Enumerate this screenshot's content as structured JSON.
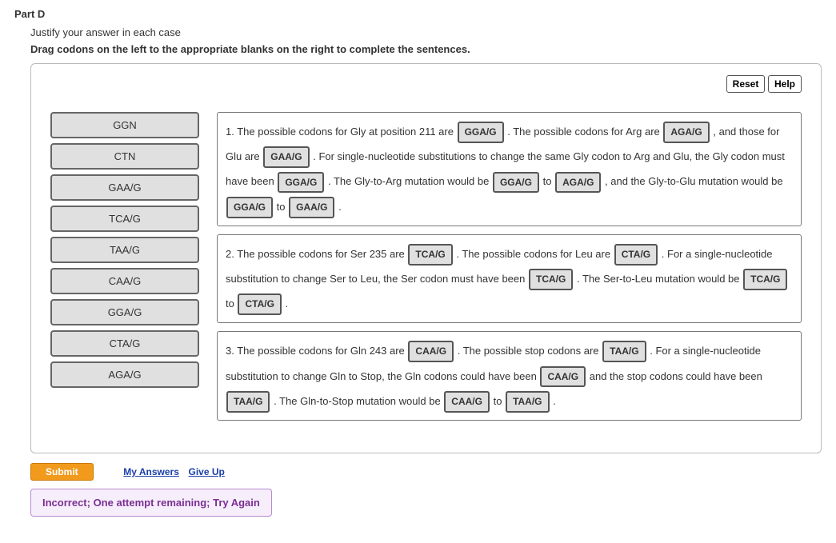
{
  "header": {
    "part_label": "Part D",
    "subtext": "Justify your answer in each case",
    "instruction": "Drag codons on the left to the appropriate blanks on the right to complete the sentences."
  },
  "buttons": {
    "reset": "Reset",
    "help": "Help",
    "submit": "Submit",
    "my_answers": "My Answers",
    "give_up": "Give Up"
  },
  "codons": [
    "GGN",
    "CTN",
    "GAA/G",
    "TCA/G",
    "TAA/G",
    "CAA/G",
    "GGA/G",
    "CTA/G",
    "AGA/G"
  ],
  "s1": {
    "t0": "1. The possible codons for Gly at position 211 are ",
    "b0": "GGA/G",
    "t1": ". The possible codons for Arg are ",
    "b1": "AGA/G",
    "t2": ", and those for Glu are ",
    "b2": "GAA/G",
    "t3": ". For single-nucleotide substitutions to change the same Gly codon to Arg and Glu, the Gly codon must have been ",
    "b3": "GGA/G",
    "t4": ". The Gly-to-Arg mutation would be ",
    "b4": "GGA/G",
    "t5": " to ",
    "b5": "AGA/G",
    "t6": ", and the Gly-to-Glu mutation would be ",
    "b6": "GGA/G",
    "t7": " to ",
    "b7": "GAA/G",
    "t8": "."
  },
  "s2": {
    "t0": "2. The possible codons for Ser 235 are ",
    "b0": "TCA/G",
    "t1": ". The possible codons for Leu are ",
    "b1": "CTA/G",
    "t2": ". For a single-nucleotide substitution to change Ser to Leu, the Ser codon must have been ",
    "b2": "TCA/G",
    "t3": ". The Ser-to-Leu mutation would be ",
    "b3": "TCA/G",
    "t4": " to ",
    "b4": "CTA/G",
    "t5": "."
  },
  "s3": {
    "t0": "3. The possible codons for Gln 243 are ",
    "b0": "CAA/G",
    "t1": ". The possible stop codons are ",
    "b1": "TAA/G",
    "t2": ". For a single-nucleotide substitution to change Gln to Stop, the Gln codons could have been ",
    "b2": "CAA/G",
    "t3": " and the stop codons could have been ",
    "b3": "TAA/G",
    "t4": ". The Gln-to-Stop mutation would be ",
    "b4": "CAA/G",
    "t5": " to ",
    "b5": "TAA/G",
    "t6": "."
  },
  "feedback": "Incorrect; One attempt remaining; Try Again"
}
